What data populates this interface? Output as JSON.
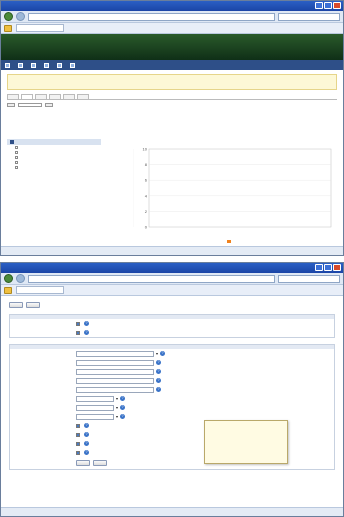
{
  "windows": {
    "top": {
      "title": "",
      "address": "",
      "search_placeholder": "",
      "tab_label": "",
      "cmd": [
        "",
        "",
        ""
      ],
      "status_text": "",
      "zone_text": "",
      "zoom_text": ""
    },
    "bottom": {
      "title": "",
      "address": "",
      "search_placeholder": "",
      "tab_label": "",
      "cmd": [
        "",
        "",
        ""
      ],
      "status_text": "",
      "zone_text": "",
      "zoom_text": ""
    }
  },
  "app": {
    "logo_top": "",
    "logo_main": "",
    "logo_accent": "",
    "top_links": [
      "",
      "",
      "",
      ""
    ],
    "user_line": "",
    "menu": [
      "",
      "",
      "",
      "",
      "",
      ""
    ]
  },
  "stats": {
    "notice": "",
    "title": "",
    "tabs": [
      "",
      "",
      "",
      "",
      "",
      ""
    ],
    "hint": "",
    "date_button": "",
    "range_select": "",
    "go_button": "",
    "date_from": "",
    "date_to": "",
    "legend_header": "",
    "legend_items": [
      "",
      "",
      "",
      "",
      ""
    ]
  },
  "chart_data": {
    "type": "bar",
    "title": "",
    "xlabel": "",
    "ylabel": "",
    "ylim": [
      0,
      10
    ],
    "categories": [],
    "values": [],
    "series": [
      {
        "name": "",
        "color": "#f0821e"
      }
    ]
  },
  "form": {
    "back_button": "",
    "next_button": "",
    "section1_title": "",
    "section1_rows": [
      {
        "label": "",
        "text": "",
        "checked": true
      },
      {
        "label": "",
        "text": "",
        "checked": true
      }
    ],
    "section2_title": "",
    "rows": [
      {
        "label": "",
        "value": "",
        "kind": "select",
        "extra": ""
      },
      {
        "label": "",
        "value": "",
        "kind": "input"
      },
      {
        "label": "",
        "value": "",
        "kind": "input"
      },
      {
        "label": "",
        "value": "",
        "kind": "input"
      },
      {
        "label": "",
        "value": "",
        "kind": "input"
      },
      {
        "label": "",
        "value": "",
        "kind": "select"
      },
      {
        "label": "",
        "value": "",
        "kind": "select"
      },
      {
        "label": "",
        "value": "",
        "kind": "select"
      },
      {
        "label": "",
        "value": "",
        "kind": "check"
      },
      {
        "label": "",
        "value": "",
        "kind": "check"
      },
      {
        "label": "",
        "value": "",
        "kind": "check"
      },
      {
        "label": "",
        "value": "",
        "kind": "check"
      }
    ],
    "tooltip_title": "",
    "tooltip_text": "",
    "footer_back": "",
    "footer_next": "",
    "footer_note": ""
  }
}
